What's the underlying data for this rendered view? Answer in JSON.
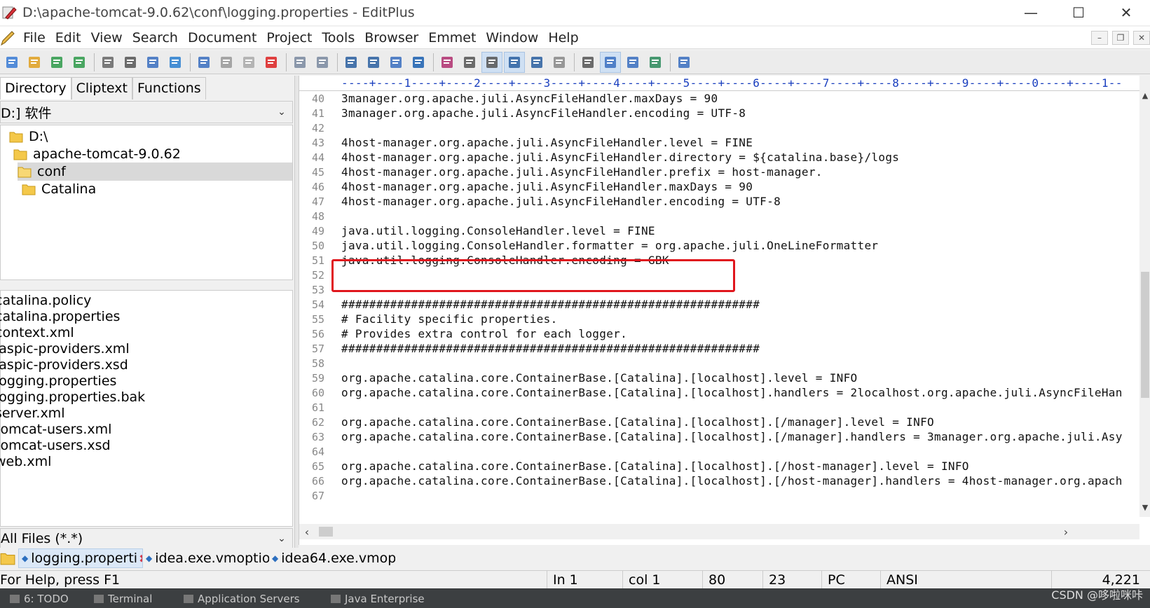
{
  "window": {
    "title": "D:\\apache-tomcat-9.0.62\\conf\\logging.properties - EditPlus"
  },
  "menu": [
    "File",
    "Edit",
    "View",
    "Search",
    "Document",
    "Project",
    "Tools",
    "Browser",
    "Emmet",
    "Window",
    "Help"
  ],
  "toolbar_icons": [
    "new-file-icon",
    "open-icon",
    "save-icon",
    "save-all-icon",
    "print-preview-icon",
    "print-icon",
    "spellcheck-icon",
    "browser-icon",
    "cut-icon",
    "copy-icon",
    "paste-icon",
    "delete-icon",
    "undo-icon",
    "redo-icon",
    "find-icon",
    "replace-icon",
    "goto-icon",
    "indent-icon",
    "font-icon",
    "hex-icon",
    "word-wrap-icon",
    "line-number-icon",
    "ruler-icon",
    "settings-icon",
    "dir-window-icon",
    "output-window-icon",
    "preview-icon",
    "full-screen-icon",
    "context-help-icon"
  ],
  "sidebar": {
    "tabs": [
      "Directory",
      "Cliptext",
      "Functions"
    ],
    "drive": "D:] 软件",
    "tree": [
      "D:\\",
      "apache-tomcat-9.0.62",
      "conf",
      "Catalina"
    ],
    "files": [
      "catalina.policy",
      "catalina.properties",
      "context.xml",
      "jaspic-providers.xml",
      "jaspic-providers.xsd",
      "logging.properties",
      "logging.properties.bak",
      "server.xml",
      "tomcat-users.xml",
      "tomcat-users.xsd",
      "web.xml"
    ],
    "filter": "All Files (*.*)"
  },
  "editor": {
    "ruler": "----+----1----+----2----+----3----+----4----+----5----+----6----+----7----+----8----+----9----+----0----+----1--",
    "lines": [
      {
        "n": "40",
        "t": "3manager.org.apache.juli.AsyncFileHandler.maxDays = 90"
      },
      {
        "n": "41",
        "t": "3manager.org.apache.juli.AsyncFileHandler.encoding = UTF-8"
      },
      {
        "n": "42",
        "t": ""
      },
      {
        "n": "43",
        "t": "4host-manager.org.apache.juli.AsyncFileHandler.level = FINE"
      },
      {
        "n": "44",
        "t": "4host-manager.org.apache.juli.AsyncFileHandler.directory = ${catalina.base}/logs"
      },
      {
        "n": "45",
        "t": "4host-manager.org.apache.juli.AsyncFileHandler.prefix = host-manager."
      },
      {
        "n": "46",
        "t": "4host-manager.org.apache.juli.AsyncFileHandler.maxDays = 90"
      },
      {
        "n": "47",
        "t": "4host-manager.org.apache.juli.AsyncFileHandler.encoding = UTF-8"
      },
      {
        "n": "48",
        "t": ""
      },
      {
        "n": "49",
        "t": "java.util.logging.ConsoleHandler.level = FINE"
      },
      {
        "n": "50",
        "t": "java.util.logging.ConsoleHandler.formatter = org.apache.juli.OneLineFormatter"
      },
      {
        "n": "51",
        "t": "java.util.logging.ConsoleHandler.encoding = GBK"
      },
      {
        "n": "52",
        "t": ""
      },
      {
        "n": "53",
        "t": ""
      },
      {
        "n": "54",
        "t": "############################################################"
      },
      {
        "n": "55",
        "t": "# Facility specific properties."
      },
      {
        "n": "56",
        "t": "# Provides extra control for each logger."
      },
      {
        "n": "57",
        "t": "############################################################"
      },
      {
        "n": "58",
        "t": ""
      },
      {
        "n": "59",
        "t": "org.apache.catalina.core.ContainerBase.[Catalina].[localhost].level = INFO"
      },
      {
        "n": "60",
        "t": "org.apache.catalina.core.ContainerBase.[Catalina].[localhost].handlers = 2localhost.org.apache.juli.AsyncFileHan"
      },
      {
        "n": "61",
        "t": ""
      },
      {
        "n": "62",
        "t": "org.apache.catalina.core.ContainerBase.[Catalina].[localhost].[/manager].level = INFO"
      },
      {
        "n": "63",
        "t": "org.apache.catalina.core.ContainerBase.[Catalina].[localhost].[/manager].handlers = 3manager.org.apache.juli.Asy"
      },
      {
        "n": "64",
        "t": ""
      },
      {
        "n": "65",
        "t": "org.apache.catalina.core.ContainerBase.[Catalina].[localhost].[/host-manager].level = INFO"
      },
      {
        "n": "66",
        "t": "org.apache.catalina.core.ContainerBase.[Catalina].[localhost].[/host-manager].handlers = 4host-manager.org.apach"
      },
      {
        "n": "67",
        "t": ""
      }
    ]
  },
  "doc_tabs": [
    "logging.properti",
    "idea.exe.vmoptio",
    "idea64.exe.vmop"
  ],
  "status": {
    "help": "For Help, press F1",
    "ln": "In 1",
    "col": "col 1",
    "width": "80",
    "lines": "23",
    "eol": "PC",
    "encoding": "ANSI",
    "size": "4,221"
  },
  "ide_strip": [
    "6: TODO",
    "Terminal",
    "Application Servers",
    "Java Enterprise"
  ],
  "watermark": "CSDN @哆啦咪咔",
  "colors": {
    "highlight": "#e0161d",
    "ruler": "#1a3fbf"
  }
}
